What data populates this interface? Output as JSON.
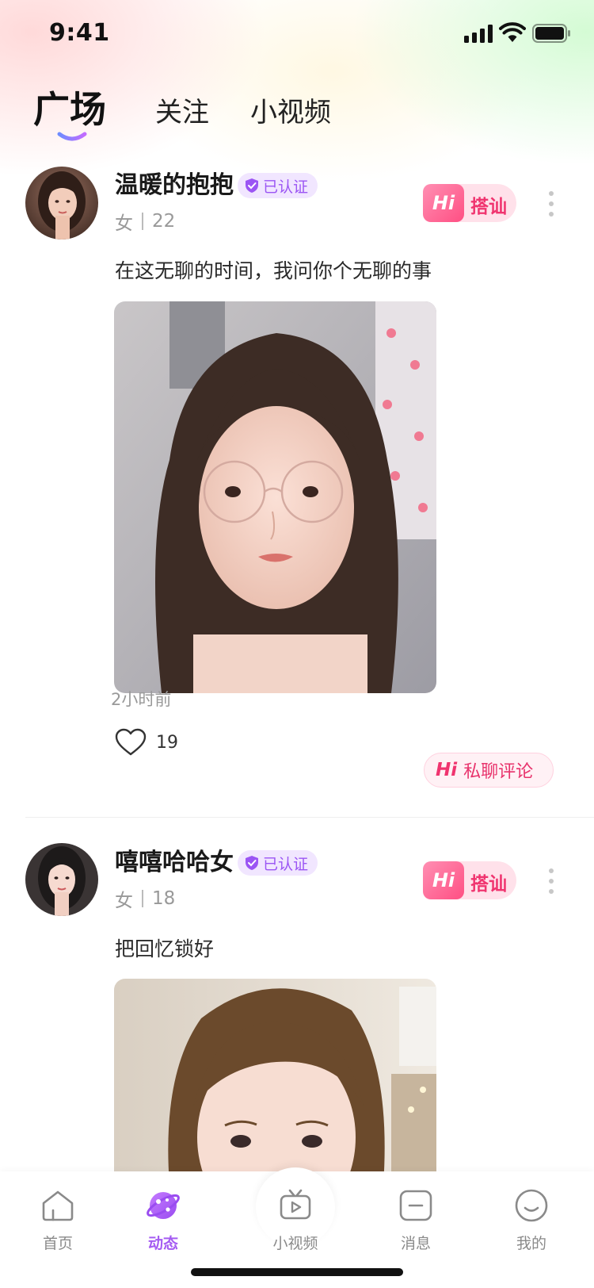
{
  "status_bar": {
    "time": "9:41"
  },
  "top_tabs": [
    {
      "label": "广场",
      "active": true
    },
    {
      "label": "关注",
      "active": false
    },
    {
      "label": "小视频",
      "active": false
    }
  ],
  "posts": [
    {
      "username": "温暖的抱抱",
      "verified_label": "已认证",
      "gender": "女",
      "age": "22",
      "greet_label": "搭讪",
      "greet_hi": "Hi",
      "content": "在这无聊的时间，我问你个无聊的事",
      "time": "2小时前",
      "likes": "19",
      "comment_label": "私聊评论",
      "comment_hi": "Hi"
    },
    {
      "username": "嘻嘻哈哈女",
      "verified_label": "已认证",
      "gender": "女",
      "age": "18",
      "greet_label": "搭讪",
      "greet_hi": "Hi",
      "content": "把回忆锁好"
    }
  ],
  "tab_bar": [
    {
      "label": "首页",
      "icon": "home-icon",
      "active": false
    },
    {
      "label": "动态",
      "icon": "planet-icon",
      "active": true
    },
    {
      "label": "小视频",
      "icon": "tv-play-icon",
      "active": false
    },
    {
      "label": "消息",
      "icon": "message-icon",
      "active": false
    },
    {
      "label": "我的",
      "icon": "smile-icon",
      "active": false
    }
  ],
  "colors": {
    "accent": "#a55cf2",
    "greet": "#f0346f",
    "verified": "#9b55f4"
  }
}
